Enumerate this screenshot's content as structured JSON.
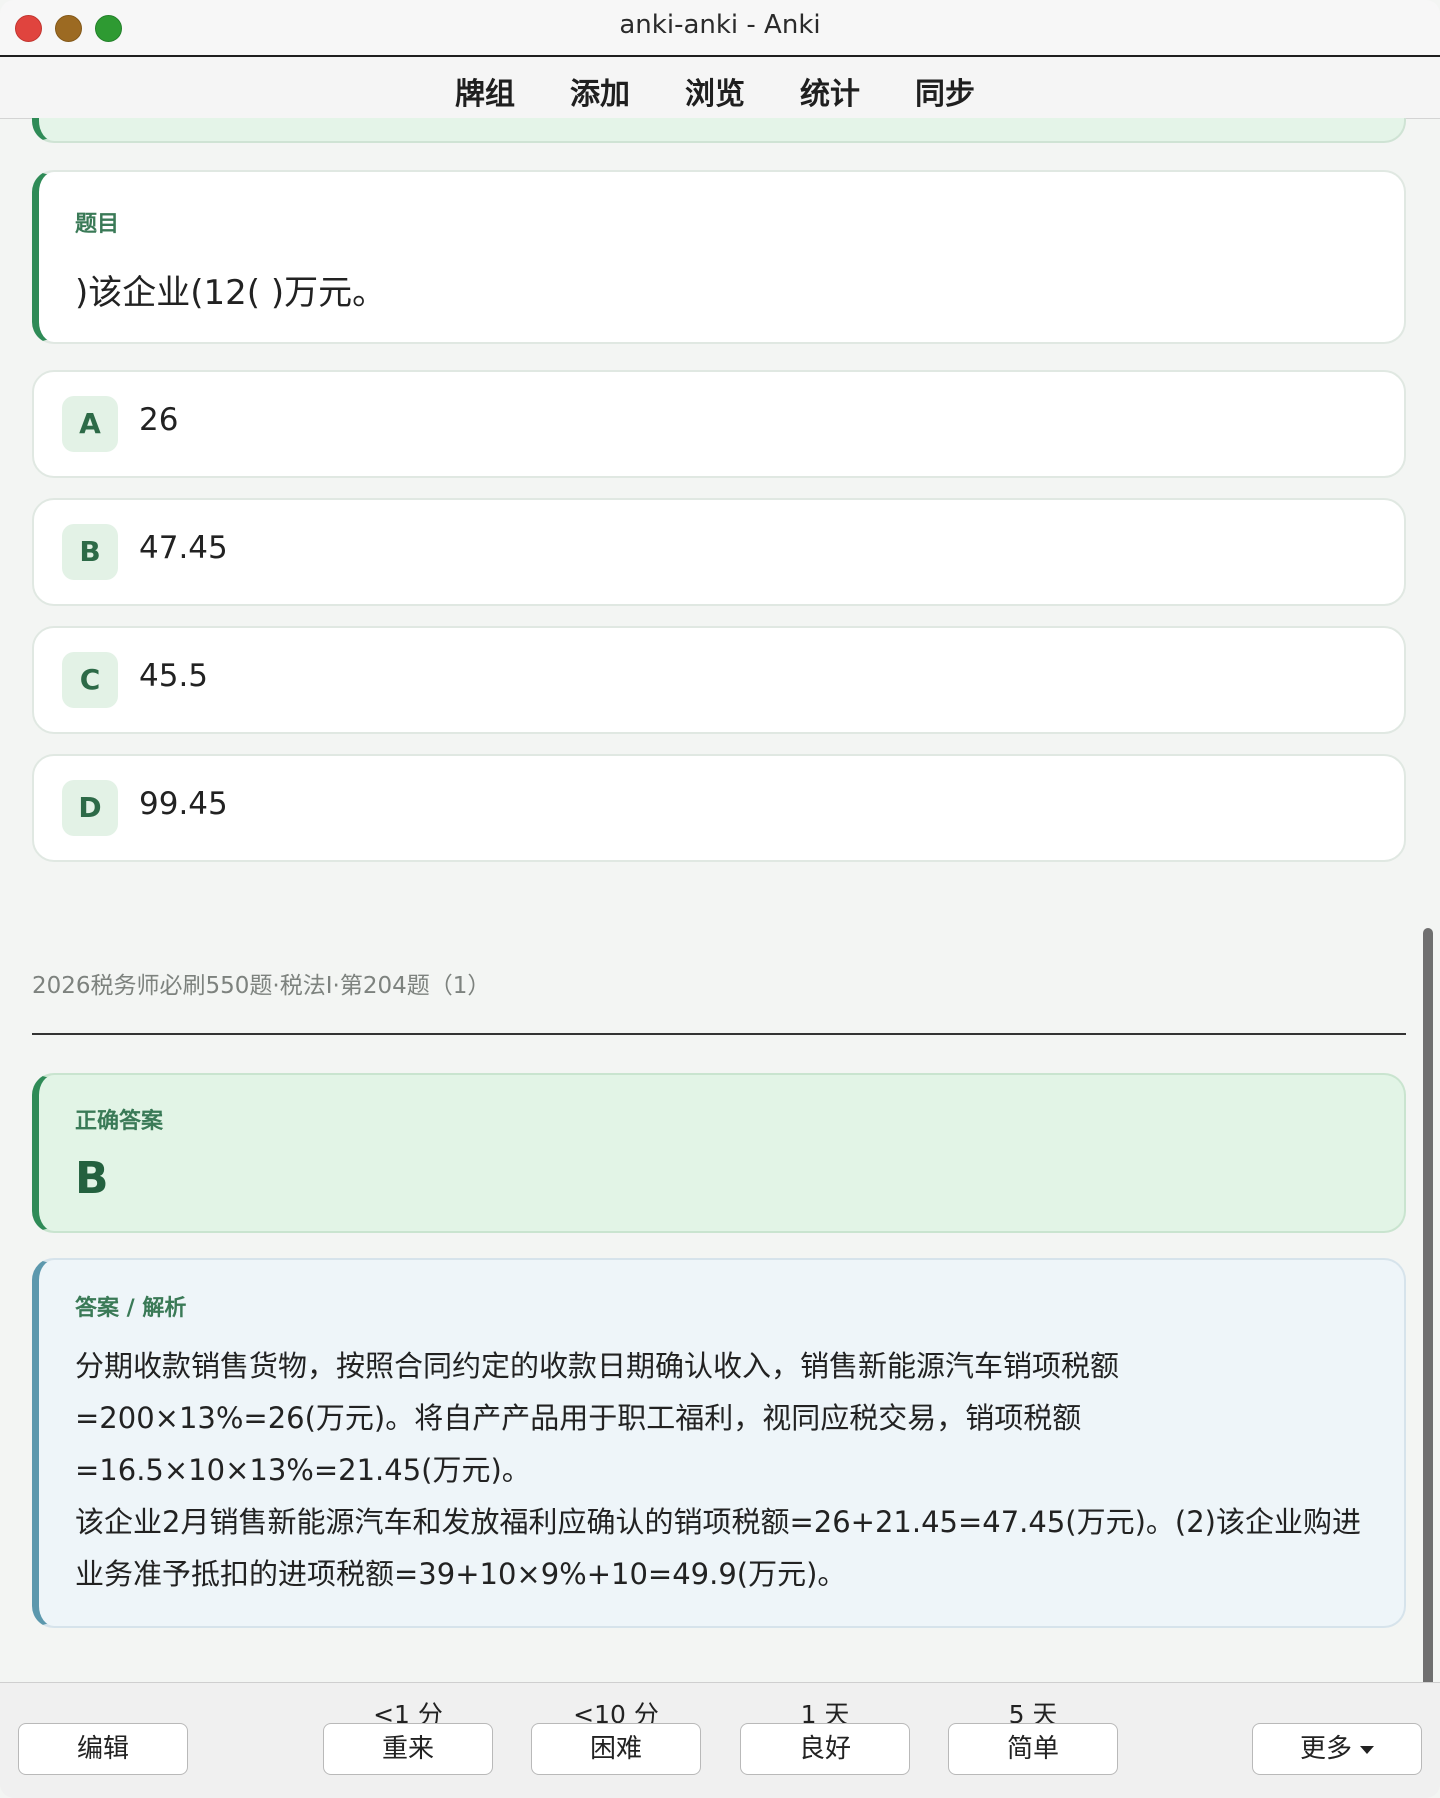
{
  "window": {
    "title": "anki-anki - Anki"
  },
  "toolbar": {
    "items": [
      "牌组",
      "添加",
      "浏览",
      "统计",
      "同步"
    ]
  },
  "question": {
    "label": "题目",
    "text": ")该企业(12( )万元。"
  },
  "options": [
    {
      "letter": "A",
      "value": "26"
    },
    {
      "letter": "B",
      "value": "47.45"
    },
    {
      "letter": "C",
      "value": "45.5"
    },
    {
      "letter": "D",
      "value": "99.45"
    }
  ],
  "source": "2026税务师必刷550题·税法I·第204题（1）",
  "answer": {
    "label": "正确答案",
    "letter": "B"
  },
  "explanation": {
    "label": "答案 / 解析",
    "lines": [
      "分期收款销售货物，按照合同约定的收款日期确认收入，销售新能源汽车销项税额",
      "=200×13%=26(万元)。将自产产品用于职工福利，视同应税交易，销项税额",
      "=16.5×10×13%=21.45(万元)。",
      "该企业2月销售新能源汽车和发放福利应确认的销项税额=26+21.45=47.45(万元)。(2)该企业购进",
      "业务准予抵扣的进项税额=39+10×9%+10=49.9(万元)。"
    ]
  },
  "bottom": {
    "edit_label": "编辑",
    "more_label": "更多",
    "ease": [
      {
        "interval": "<1 分",
        "label": "重来"
      },
      {
        "interval": "<10 分",
        "label": "困难"
      },
      {
        "interval": "1 天",
        "label": "良好"
      },
      {
        "interval": "5 天",
        "label": "简单"
      }
    ]
  },
  "colors": {
    "accent_green": "#2f8b57",
    "accent_blue": "#5c98ad",
    "answer_bg": "#e2f4e6",
    "explanation_bg": "#eef5f9"
  }
}
